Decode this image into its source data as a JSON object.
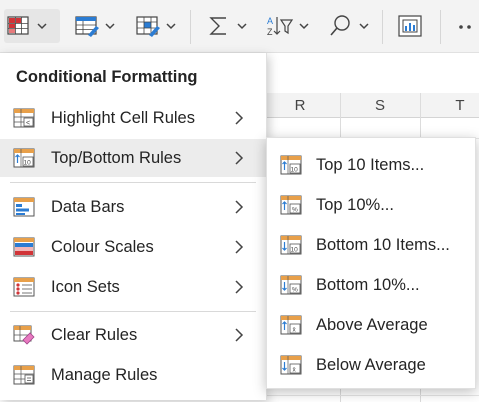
{
  "ribbon": {
    "buttons": [
      {
        "name": "conditional-formatting-button",
        "icon": "conditional-formatting-icon"
      },
      {
        "name": "format-as-table-button",
        "icon": "format-as-table-icon"
      },
      {
        "name": "cell-styles-button",
        "icon": "cell-styles-icon"
      },
      {
        "name": "autosum-button",
        "icon": "sigma-icon"
      },
      {
        "name": "sort-filter-button",
        "icon": "sort-filter-icon"
      },
      {
        "name": "find-select-button",
        "icon": "magnifier-icon"
      },
      {
        "name": "analyze-data-button",
        "icon": "analyze-data-icon"
      },
      {
        "name": "more-options-button",
        "icon": "ellipsis-icon"
      }
    ]
  },
  "sheet": {
    "columns": [
      "R",
      "S",
      "T"
    ]
  },
  "menu": {
    "title": "Conditional Formatting",
    "items": [
      {
        "label": "Highlight Cell Rules",
        "icon": "highlight-cell-rules-icon",
        "submenu": true
      },
      {
        "label": "Top/Bottom Rules",
        "icon": "top-bottom-rules-icon",
        "submenu": true,
        "active": true
      },
      {
        "label": "Data Bars",
        "icon": "data-bars-icon",
        "submenu": true
      },
      {
        "label": "Colour Scales",
        "icon": "colour-scales-icon",
        "submenu": true
      },
      {
        "label": "Icon Sets",
        "icon": "icon-sets-icon",
        "submenu": true
      },
      {
        "label": "Clear Rules",
        "icon": "clear-rules-icon",
        "submenu": true
      },
      {
        "label": "Manage Rules",
        "icon": "manage-rules-icon",
        "submenu": false
      }
    ]
  },
  "submenu": {
    "items": [
      {
        "label": "Top 10 Items...",
        "icon": "top-10-items-icon",
        "badge": "10"
      },
      {
        "label": "Top 10%...",
        "icon": "top-10-percent-icon",
        "badge": "%"
      },
      {
        "label": "Bottom 10 Items...",
        "icon": "bottom-10-items-icon",
        "badge": "10"
      },
      {
        "label": "Bottom 10%...",
        "icon": "bottom-10-percent-icon",
        "badge": "%"
      },
      {
        "label": "Above Average",
        "icon": "above-average-icon",
        "badge": "x̄"
      },
      {
        "label": "Below Average",
        "icon": "below-average-icon",
        "badge": "x̄"
      }
    ]
  },
  "colors": {
    "accent_blue": "#2b7cd3",
    "accent_red": "#d13438",
    "hover_bg": "#ececec"
  }
}
